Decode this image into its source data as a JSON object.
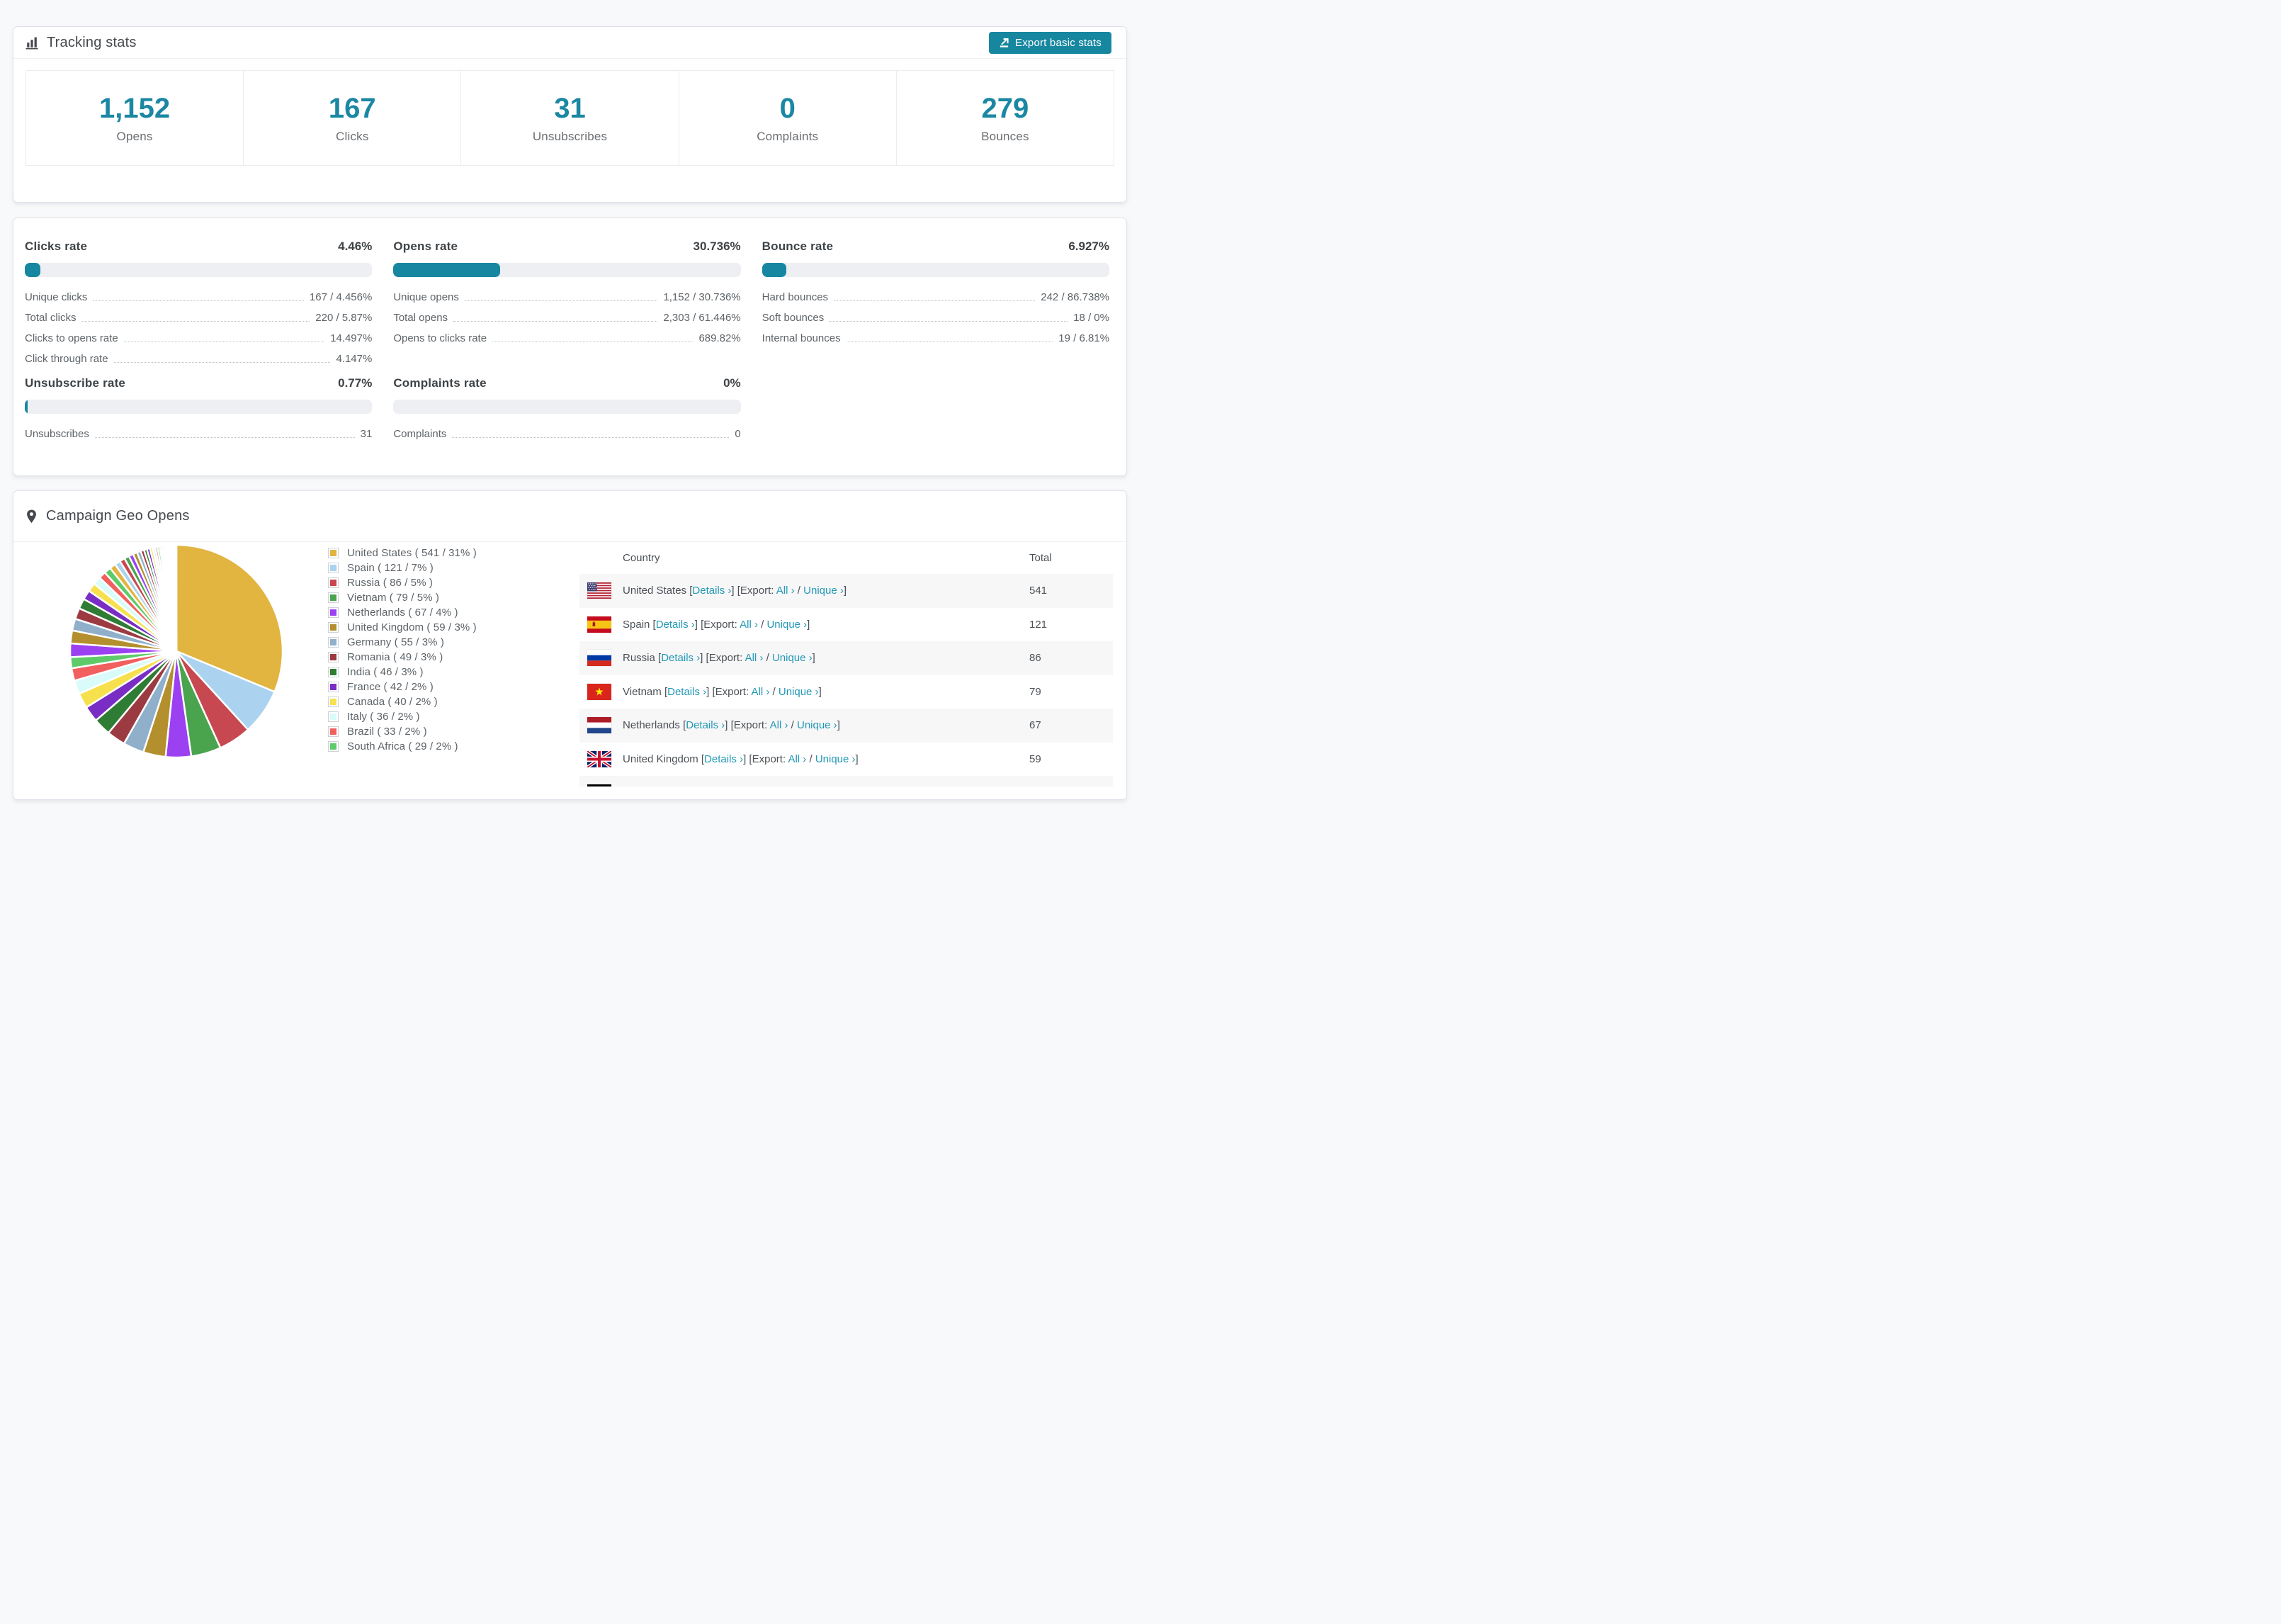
{
  "page": {
    "accent": "#1787a1",
    "link_color": "#2398b5"
  },
  "tracking": {
    "title": "Tracking stats",
    "export_button": "Export basic stats",
    "stats": [
      {
        "value": "1,152",
        "label": "Opens"
      },
      {
        "value": "167",
        "label": "Clicks"
      },
      {
        "value": "31",
        "label": "Unsubscribes"
      },
      {
        "value": "0",
        "label": "Complaints"
      },
      {
        "value": "279",
        "label": "Bounces"
      }
    ]
  },
  "rates": {
    "blocks": [
      {
        "title": "Clicks rate",
        "value": "4.46%",
        "percent": 4.46,
        "rows": [
          {
            "label": "Unique clicks",
            "value": "167 / 4.456%"
          },
          {
            "label": "Total clicks",
            "value": "220 / 5.87%"
          },
          {
            "label": "Clicks to opens rate",
            "value": "14.497%"
          },
          {
            "label": "Click through rate",
            "value": "4.147%"
          }
        ]
      },
      {
        "title": "Opens rate",
        "value": "30.736%",
        "percent": 30.736,
        "rows": [
          {
            "label": "Unique opens",
            "value": "1,152 / 30.736%"
          },
          {
            "label": "Total opens",
            "value": "2,303 / 61.446%"
          },
          {
            "label": "Opens to clicks rate",
            "value": "689.82%"
          }
        ]
      },
      {
        "title": "Bounce rate",
        "value": "6.927%",
        "percent": 6.927,
        "rows": [
          {
            "label": "Hard bounces",
            "value": "242 / 86.738%"
          },
          {
            "label": "Soft bounces",
            "value": "18 / 0%"
          },
          {
            "label": "Internal bounces",
            "value": "19 / 6.81%"
          }
        ]
      },
      {
        "title": "Unsubscribe rate",
        "value": "0.77%",
        "percent": 0.77,
        "rows": [
          {
            "label": "Unsubscribes",
            "value": "31"
          }
        ]
      },
      {
        "title": "Complaints rate",
        "value": "0%",
        "percent": 0,
        "rows": [
          {
            "label": "Complaints",
            "value": "0"
          }
        ]
      }
    ]
  },
  "geo": {
    "title": "Campaign Geo Opens",
    "table": {
      "country_header": "Country",
      "total_header": "Total",
      "link_details": "Details ›",
      "link_all": "All ›",
      "link_unique": "Unique ›",
      "export_word": "Export:",
      "rows": [
        {
          "flag": "us",
          "country": "United States",
          "total": "541"
        },
        {
          "flag": "es",
          "country": "Spain",
          "total": "121"
        },
        {
          "flag": "ru",
          "country": "Russia",
          "total": "86"
        },
        {
          "flag": "vn",
          "country": "Vietnam",
          "total": "79"
        },
        {
          "flag": "nl",
          "country": "Netherlands",
          "total": "67"
        },
        {
          "flag": "gb",
          "country": "United Kingdom",
          "total": "59"
        },
        {
          "flag": "de",
          "country": "",
          "total": "",
          "partial": true
        }
      ]
    }
  },
  "chart_data": {
    "type": "pie",
    "title": "Campaign Geo Opens",
    "legend_position": "right",
    "start_angle_deg": 0,
    "direction": "clockwise",
    "legend_format": "{label} ( {count} / {pct}% )",
    "slices": [
      {
        "label": "United States",
        "count": 541,
        "pct": 31,
        "color": "#e2b440"
      },
      {
        "label": "Spain",
        "count": 121,
        "pct": 7,
        "color": "#abd3f0"
      },
      {
        "label": "Russia",
        "count": 86,
        "pct": 5,
        "color": "#c74850"
      },
      {
        "label": "Vietnam",
        "count": 79,
        "pct": 5,
        "color": "#4aa44e"
      },
      {
        "label": "Netherlands",
        "count": 67,
        "pct": 4,
        "color": "#9c41f2"
      },
      {
        "label": "United Kingdom",
        "count": 59,
        "pct": 3,
        "color": "#b38f2d"
      },
      {
        "label": "Germany",
        "count": 55,
        "pct": 3,
        "color": "#8fafca"
      },
      {
        "label": "Romania",
        "count": 49,
        "pct": 3,
        "color": "#9c3a42"
      },
      {
        "label": "India",
        "count": 46,
        "pct": 3,
        "color": "#2f7c35"
      },
      {
        "label": "France",
        "count": 42,
        "pct": 2,
        "color": "#7a2dc4"
      },
      {
        "label": "Canada",
        "count": 40,
        "pct": 2,
        "color": "#f6e04e"
      },
      {
        "label": "Italy",
        "count": 36,
        "pct": 2,
        "color": "#d9fbfa"
      },
      {
        "label": "Brazil",
        "count": 33,
        "pct": 2,
        "color": "#f25f5f"
      },
      {
        "label": "South Africa",
        "count": 29,
        "pct": 2,
        "color": "#5ecb68"
      }
    ],
    "other_slices_weights": [
      36,
      34,
      31,
      29,
      27,
      25,
      23,
      21,
      19,
      18,
      16,
      15,
      14,
      13,
      12,
      11,
      10,
      9,
      8,
      8,
      7,
      7,
      6,
      6,
      5,
      5,
      4,
      4,
      3,
      3,
      3,
      2,
      2,
      2,
      2,
      1,
      1,
      1,
      1,
      1,
      1,
      0.8,
      0.6,
      0.5,
      0.4,
      0.3
    ]
  }
}
